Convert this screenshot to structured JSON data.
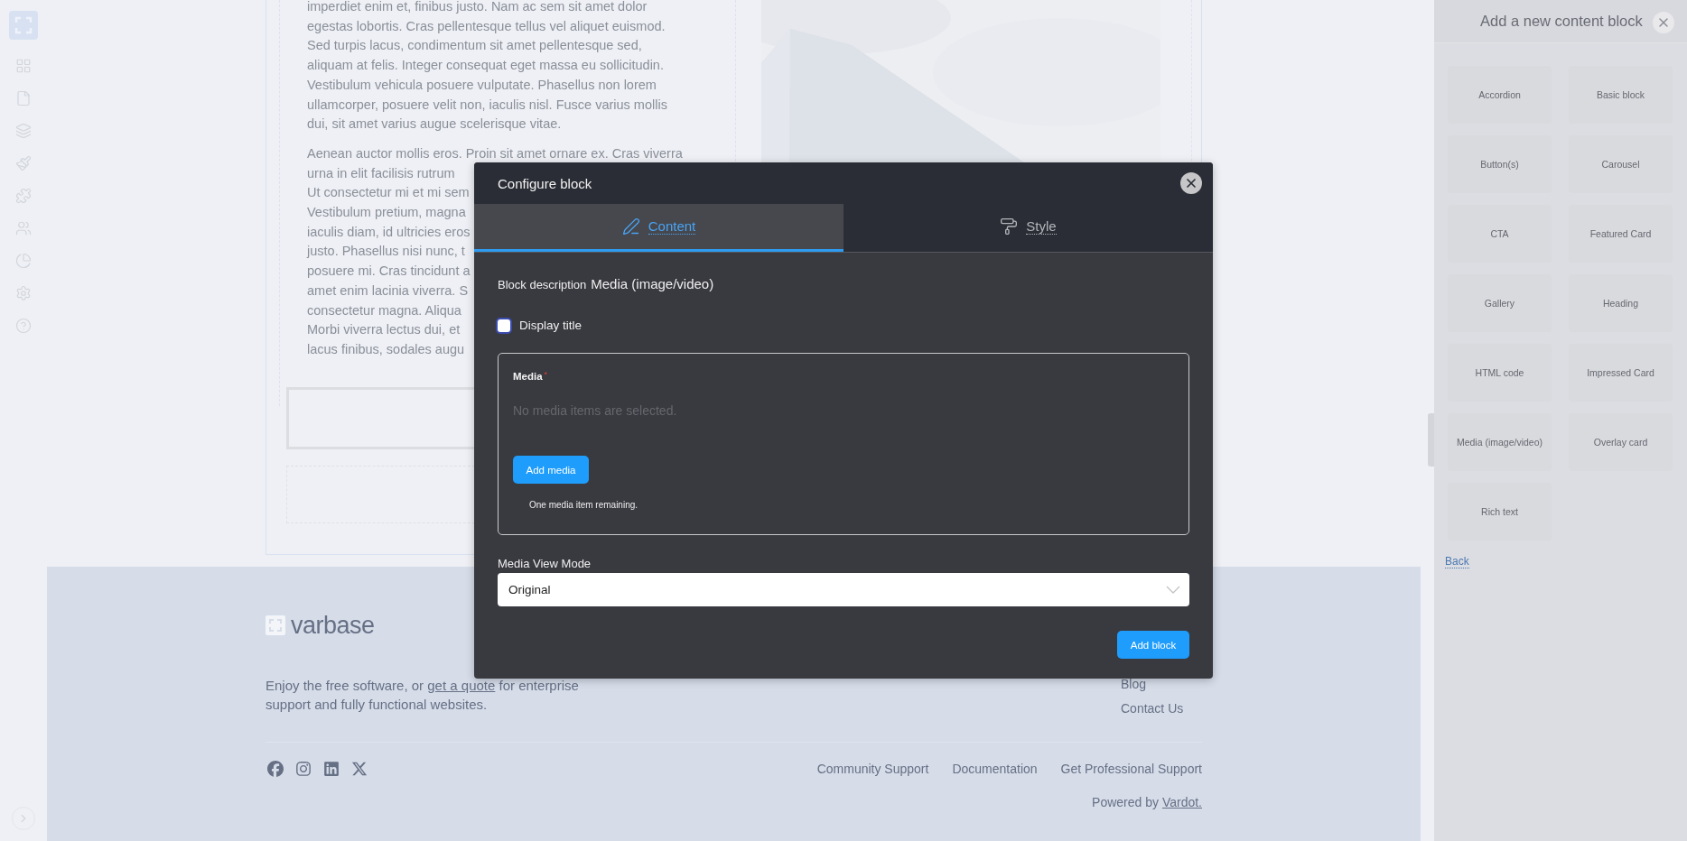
{
  "content": {
    "paragraph": "imperdiet enim et, finibus justo. Nam ac sem sit amet dolor egestas lobortis. Cras pellentesque tellus vel aliquet euismod. Sed turpis lacus, condimentum sit amet pellentesque sed, aliquam at felis. Integer consequat eget massa eu sollicitudin. Vestibulum vehicula posuere vulputate. Phasellus non lorem ullamcorper, posuere velit non, iaculis nisl. Fusce varius mollis dui, sit amet varius augue scelerisque vitae.",
    "paragraph_2_lines": [
      "Aenean auctor mollis eros. Proin sit amet ornare ex. Cras viverra",
      "urna in elit facilisis rutrum",
      "Ut consectetur mi et mi sem",
      "Vestibulum pretium, magna",
      "iaculis diam, id ultricies eros",
      "justo. Phasellus nisi nunc, t",
      "posuere mi. Cras tincidunt a",
      "amet enim lacinia viverra. S",
      "consectetur magna. Aliqua",
      "Morbi viverra lectus dui, et",
      "lacus finibus, sodales augu"
    ]
  },
  "footer": {
    "logo": "varbase",
    "tagline_before": "Enjoy the free software, or ",
    "tagline_link": "get a quote",
    "tagline_after": " for enterprise support and fully functional websites.",
    "links": [
      "Blog",
      "Contact Us"
    ],
    "bottom_links": [
      "Community Support",
      "Documentation",
      "Get Professional Support"
    ],
    "powered_by": "Powered by ",
    "powered_link": "Vardot."
  },
  "panel": {
    "title": "Add a new content block",
    "blocks": [
      "Accordion",
      "Basic block",
      "Button(s)",
      "Carousel",
      "CTA",
      "Featured Card",
      "Gallery",
      "Heading",
      "HTML code",
      "Impressed Card",
      "Media (image/video)",
      "Overlay card",
      "Rich text"
    ],
    "back": "Back"
  },
  "dialog": {
    "title": "Configure block",
    "tabs": [
      {
        "label": "Content",
        "selected": true
      },
      {
        "label": "Style",
        "selected": false
      }
    ],
    "description_label": "Block description",
    "description_value": "Media (image/video)",
    "display_title": {
      "label": "Display title",
      "checked": false
    },
    "media": {
      "label": "Media",
      "required_mark": "*",
      "empty_text": "No media items are selected.",
      "button": "Add media",
      "remaining": "One media item remaining."
    },
    "view_mode": {
      "label": "Media View Mode",
      "value": "Original"
    },
    "submit": "Add block"
  }
}
